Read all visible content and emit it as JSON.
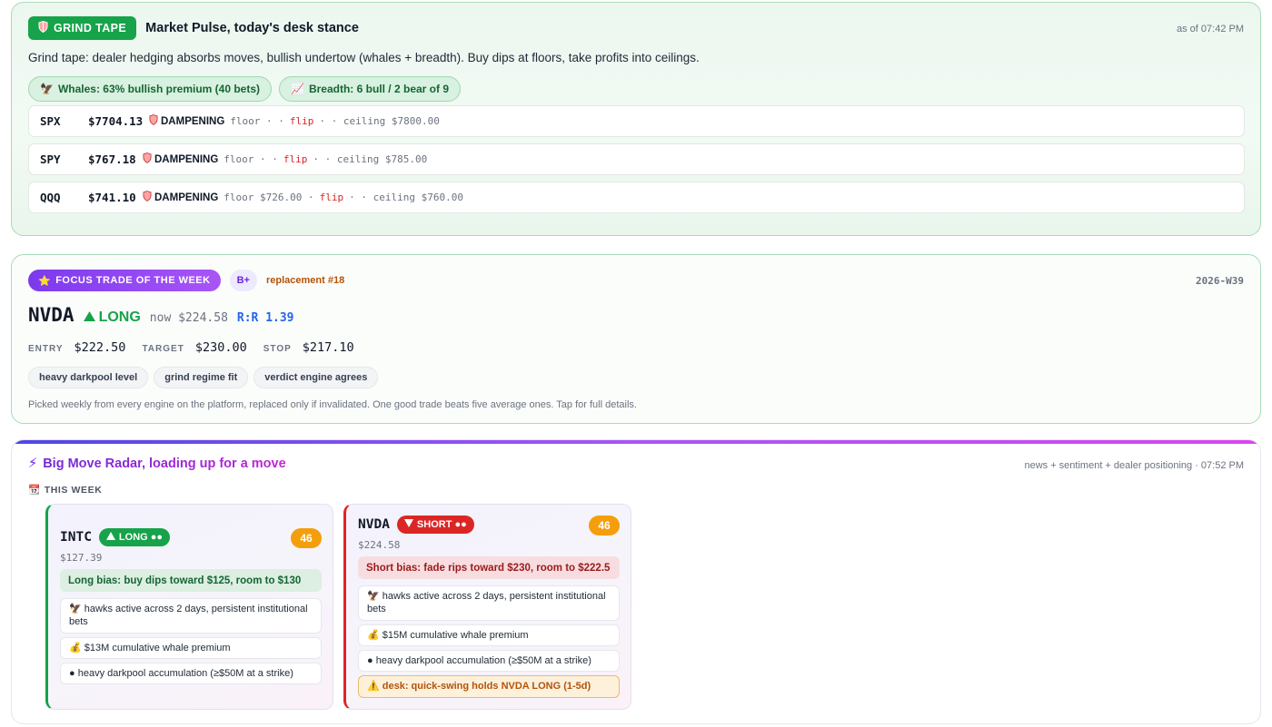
{
  "pulse": {
    "badge": "GRIND TAPE",
    "badge_icon": "shield",
    "title": "Market Pulse, today's desk stance",
    "as_of": "as of 07:42 PM",
    "description": "Grind tape: dealer hedging absorbs moves, bullish undertow (whales + breadth). Buy dips at floors, take profits into ceilings.",
    "chips": [
      {
        "icon": "eagle",
        "text": "Whales: 63% bullish premium (40 bets)"
      },
      {
        "icon": "chart-up",
        "text": "Breadth: 6 bull / 2 bear of 9"
      }
    ],
    "indices": [
      {
        "symbol": "SPX",
        "price": "$7704.13",
        "regime": "DAMPENING",
        "floor": "floor · ·",
        "flip": "flip",
        "ceiling": "· · ceiling $7800.00"
      },
      {
        "symbol": "SPY",
        "price": "$767.18",
        "regime": "DAMPENING",
        "floor": "floor · ·",
        "flip": "flip",
        "ceiling": "· · ceiling $785.00"
      },
      {
        "symbol": "QQQ",
        "price": "$741.10",
        "regime": "DAMPENING",
        "floor": "floor $726.00 ·",
        "flip": "flip",
        "ceiling": "· · ceiling $760.00"
      }
    ]
  },
  "focus": {
    "badge": "FOCUS TRADE OF THE WEEK",
    "grade": "B+",
    "replacement": "replacement #18",
    "week": "2026-W39",
    "symbol": "NVDA",
    "direction": "LONG",
    "now": "now $224.58",
    "rr": "R:R 1.39",
    "entry_label": "ENTRY",
    "entry": "$222.50",
    "target_label": "TARGET",
    "target": "$230.00",
    "stop_label": "STOP",
    "stop": "$217.10",
    "tags": [
      "heavy darkpool level",
      "grind regime fit",
      "verdict engine agrees"
    ],
    "footnote": "Picked weekly from every engine on the platform, replaced only if invalidated. One good trade beats five average ones. Tap for full details."
  },
  "radar": {
    "title": "Big Move Radar, loading up for a move",
    "meta": "news + sentiment + dealer positioning · 07:52 PM",
    "week_label": "THIS WEEK",
    "cards": [
      {
        "symbol": "INTC",
        "direction": "LONG ●●",
        "score": "46",
        "price": "$127.39",
        "bias": "Long bias: buy dips toward $125, room to $130",
        "notes": [
          "hawks active across 2 days, persistent institutional bets",
          "$13M cumulative whale premium",
          "heavy darkpool accumulation (≥$50M at a strike)"
        ]
      },
      {
        "symbol": "NVDA",
        "direction": "SHORT ●●",
        "score": "46",
        "price": "$224.58",
        "bias": "Short bias: fade rips toward $230, room to $222.5",
        "notes": [
          "hawks active across 2 days, persistent institutional bets",
          "$15M cumulative whale premium",
          "heavy darkpool accumulation (≥$50M at a strike)"
        ],
        "warning": "desk: quick-swing holds NVDA LONG (1-5d)"
      }
    ]
  },
  "colors": {
    "bull": "#16a34a",
    "bear": "#dc2626",
    "accent": "#7c3aed",
    "score": "#f59e0b"
  }
}
